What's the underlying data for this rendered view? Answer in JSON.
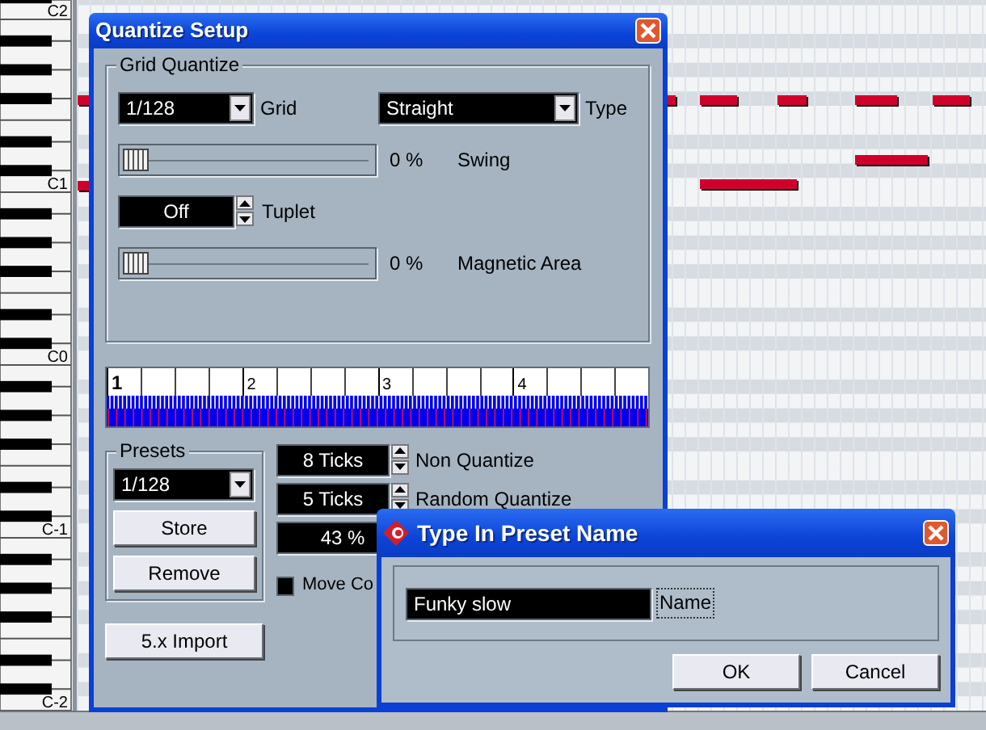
{
  "piano_roll": {
    "key_labels": [
      "C2",
      "C1",
      "C0",
      "C-1",
      "C-2"
    ]
  },
  "quantize_setup": {
    "title": "Quantize Setup",
    "grid_quantize": {
      "legend": "Grid Quantize",
      "grid": {
        "value": "1/128",
        "label": "Grid"
      },
      "type": {
        "value": "Straight",
        "label": "Type"
      },
      "swing": {
        "level": 0,
        "reading": "0 %",
        "label": "Swing"
      },
      "tuplet": {
        "value": "Off",
        "label": "Tuplet"
      },
      "magnetic_area": {
        "level": 0,
        "reading": "0 %",
        "label": "Magnetic Area"
      }
    },
    "ruler": {
      "beats": [
        "1",
        "2",
        "3",
        "4"
      ]
    },
    "presets": {
      "legend": "Presets",
      "value": "1/128",
      "buttons": [
        "Store",
        "Remove"
      ]
    },
    "non_quantize": {
      "value": "8 Ticks",
      "label": "Non Quantize"
    },
    "random_quantize": {
      "value": "5 Ticks",
      "label": "Random Quantize"
    },
    "field_3": {
      "value": "43 %"
    },
    "checkbox": {
      "label": "Move Co",
      "checked": false
    },
    "import_button": "5.x Import"
  },
  "preset_name_dialog": {
    "title": "Type In Preset Name",
    "name": {
      "value": "Funky slow",
      "label": "Name"
    },
    "buttons": [
      "OK",
      "Cancel"
    ]
  }
}
